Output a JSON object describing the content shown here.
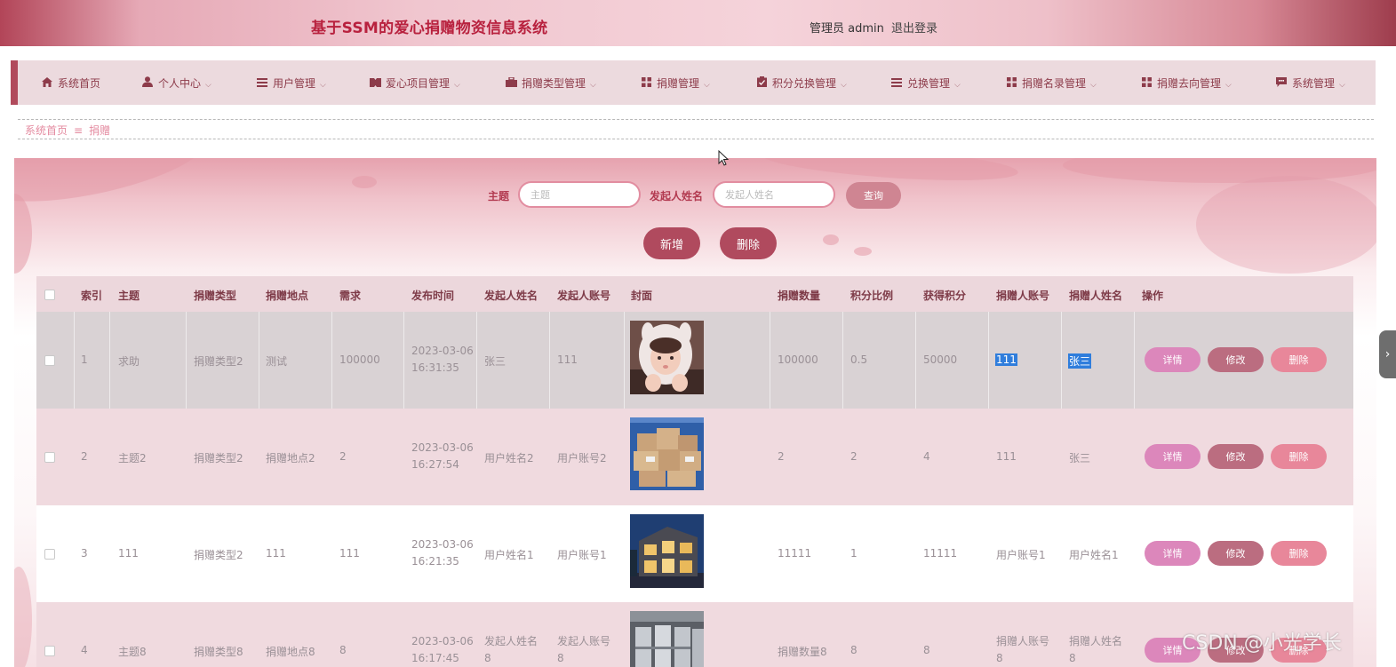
{
  "header": {
    "title": "基于SSM的爱心捐赠物资信息系统",
    "user_label": "管理员 admin",
    "logout_label": "退出登录"
  },
  "nav": {
    "items": [
      {
        "label": "系统首页",
        "icon": "home-icon",
        "has_dropdown": false
      },
      {
        "label": "个人中心",
        "icon": "user-icon",
        "has_dropdown": true
      },
      {
        "label": "用户管理",
        "icon": "list-icon",
        "has_dropdown": true
      },
      {
        "label": "爱心项目管理",
        "icon": "ticket-icon",
        "has_dropdown": true
      },
      {
        "label": "捐赠类型管理",
        "icon": "briefcase-icon",
        "has_dropdown": true
      },
      {
        "label": "捐赠管理",
        "icon": "grid-icon",
        "has_dropdown": true
      },
      {
        "label": "积分兑换管理",
        "icon": "clipboard-icon",
        "has_dropdown": true
      },
      {
        "label": "兑换管理",
        "icon": "list-icon",
        "has_dropdown": true
      },
      {
        "label": "捐赠名录管理",
        "icon": "grid-icon",
        "has_dropdown": true
      },
      {
        "label": "捐赠去向管理",
        "icon": "grid-icon",
        "has_dropdown": true
      },
      {
        "label": "系统管理",
        "icon": "chat-icon",
        "has_dropdown": true
      }
    ]
  },
  "breadcrumb": {
    "home": "系统首页",
    "separator": "≡",
    "current": "捐赠"
  },
  "search": {
    "subject_label": "主题",
    "subject_placeholder": "主题",
    "subject_value": "",
    "initiator_label": "发起人姓名",
    "initiator_placeholder": "发起人姓名",
    "initiator_value": "",
    "query_button": "查询"
  },
  "actions": {
    "add_button": "新增",
    "delete_button": "删除"
  },
  "table": {
    "headers": [
      "索引",
      "主题",
      "捐赠类型",
      "捐赠地点",
      "需求",
      "发布时间",
      "发起人姓名",
      "发起人账号",
      "封面",
      "捐赠数量",
      "积分比例",
      "获得积分",
      "捐赠人账号",
      "捐赠人姓名",
      "操作"
    ],
    "op_labels": {
      "detail": "详情",
      "edit": "修改",
      "remove": "删除"
    },
    "rows": [
      {
        "index": "1",
        "subject": "求助",
        "type": "捐赠类型2",
        "place": "测试",
        "demand": "100000",
        "date": "2023-03-06",
        "time": "16:31:35",
        "initiator_name": "张三",
        "initiator_account": "111",
        "cover": "girl-photo",
        "quantity": "100000",
        "ratio": "0.5",
        "points": "50000",
        "donor_account": "111",
        "donor_name": "张三"
      },
      {
        "index": "2",
        "subject": "主题2",
        "type": "捐赠类型2",
        "place": "捐赠地点2",
        "demand": "2",
        "date": "2023-03-06",
        "time": "16:27:54",
        "initiator_name": "用户姓名2",
        "initiator_account": "用户账号2",
        "cover": "boxes-photo",
        "quantity": "2",
        "ratio": "2",
        "points": "4",
        "donor_account": "111",
        "donor_name": "张三"
      },
      {
        "index": "3",
        "subject": "111",
        "type": "捐赠类型2",
        "place": "111",
        "demand": "111",
        "date": "2023-03-06",
        "time": "16:21:35",
        "initiator_name": "用户姓名1",
        "initiator_account": "用户账号1",
        "cover": "house-photo",
        "quantity": "11111",
        "ratio": "1",
        "points": "11111",
        "donor_account": "用户账号1",
        "donor_name": "用户姓名1"
      },
      {
        "index": "4",
        "subject": "主题8",
        "type": "捐赠类型8",
        "place": "捐赠地点8",
        "demand": "8",
        "date": "2023-03-06",
        "time": "16:17:45",
        "initiator_name": "发起人姓名",
        "initiator_name_2": "8",
        "initiator_account": "发起人账号",
        "initiator_account_2": "8",
        "cover": "warehouse-photo",
        "quantity": "捐赠数量8",
        "ratio": "8",
        "points": "8",
        "donor_account": "捐赠人账号",
        "donor_account_2": "8",
        "donor_name": "捐赠人姓名",
        "donor_name_2": "8"
      }
    ]
  },
  "watermark": "CSDN @小光学长",
  "colors": {
    "brand": "#b8213e",
    "nav_bg": "#ecdade",
    "button": "#b04a5e",
    "detail_button": "#dc87bb",
    "edit_button": "#bb6d80",
    "remove_button": "#e8879a",
    "selection": "#2f7ddc"
  }
}
